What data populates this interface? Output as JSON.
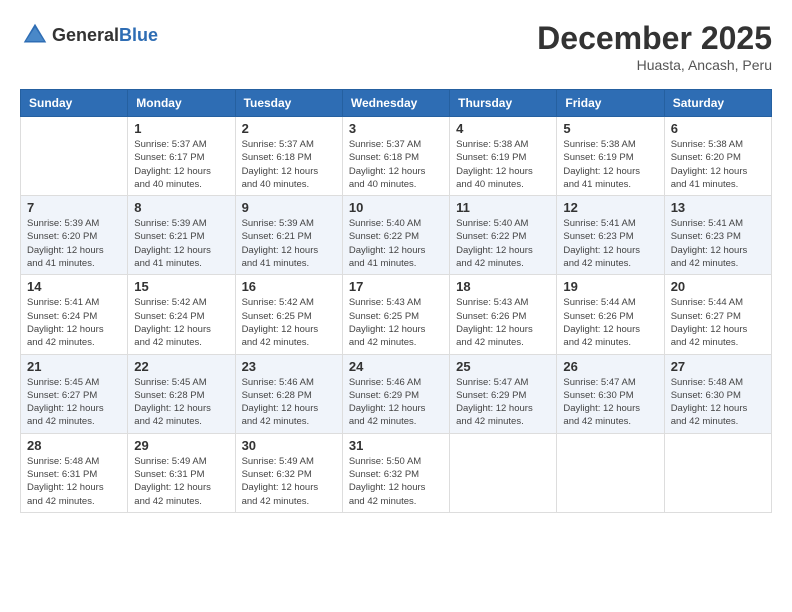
{
  "header": {
    "logo_general": "General",
    "logo_blue": "Blue",
    "title": "December 2025",
    "location": "Huasta, Ancash, Peru"
  },
  "weekdays": [
    "Sunday",
    "Monday",
    "Tuesday",
    "Wednesday",
    "Thursday",
    "Friday",
    "Saturday"
  ],
  "weeks": [
    [
      {
        "day": "",
        "info": ""
      },
      {
        "day": "1",
        "info": "Sunrise: 5:37 AM\nSunset: 6:17 PM\nDaylight: 12 hours\nand 40 minutes."
      },
      {
        "day": "2",
        "info": "Sunrise: 5:37 AM\nSunset: 6:18 PM\nDaylight: 12 hours\nand 40 minutes."
      },
      {
        "day": "3",
        "info": "Sunrise: 5:37 AM\nSunset: 6:18 PM\nDaylight: 12 hours\nand 40 minutes."
      },
      {
        "day": "4",
        "info": "Sunrise: 5:38 AM\nSunset: 6:19 PM\nDaylight: 12 hours\nand 40 minutes."
      },
      {
        "day": "5",
        "info": "Sunrise: 5:38 AM\nSunset: 6:19 PM\nDaylight: 12 hours\nand 41 minutes."
      },
      {
        "day": "6",
        "info": "Sunrise: 5:38 AM\nSunset: 6:20 PM\nDaylight: 12 hours\nand 41 minutes."
      }
    ],
    [
      {
        "day": "7",
        "info": "Sunrise: 5:39 AM\nSunset: 6:20 PM\nDaylight: 12 hours\nand 41 minutes."
      },
      {
        "day": "8",
        "info": "Sunrise: 5:39 AM\nSunset: 6:21 PM\nDaylight: 12 hours\nand 41 minutes."
      },
      {
        "day": "9",
        "info": "Sunrise: 5:39 AM\nSunset: 6:21 PM\nDaylight: 12 hours\nand 41 minutes."
      },
      {
        "day": "10",
        "info": "Sunrise: 5:40 AM\nSunset: 6:22 PM\nDaylight: 12 hours\nand 41 minutes."
      },
      {
        "day": "11",
        "info": "Sunrise: 5:40 AM\nSunset: 6:22 PM\nDaylight: 12 hours\nand 42 minutes."
      },
      {
        "day": "12",
        "info": "Sunrise: 5:41 AM\nSunset: 6:23 PM\nDaylight: 12 hours\nand 42 minutes."
      },
      {
        "day": "13",
        "info": "Sunrise: 5:41 AM\nSunset: 6:23 PM\nDaylight: 12 hours\nand 42 minutes."
      }
    ],
    [
      {
        "day": "14",
        "info": "Sunrise: 5:41 AM\nSunset: 6:24 PM\nDaylight: 12 hours\nand 42 minutes."
      },
      {
        "day": "15",
        "info": "Sunrise: 5:42 AM\nSunset: 6:24 PM\nDaylight: 12 hours\nand 42 minutes."
      },
      {
        "day": "16",
        "info": "Sunrise: 5:42 AM\nSunset: 6:25 PM\nDaylight: 12 hours\nand 42 minutes."
      },
      {
        "day": "17",
        "info": "Sunrise: 5:43 AM\nSunset: 6:25 PM\nDaylight: 12 hours\nand 42 minutes."
      },
      {
        "day": "18",
        "info": "Sunrise: 5:43 AM\nSunset: 6:26 PM\nDaylight: 12 hours\nand 42 minutes."
      },
      {
        "day": "19",
        "info": "Sunrise: 5:44 AM\nSunset: 6:26 PM\nDaylight: 12 hours\nand 42 minutes."
      },
      {
        "day": "20",
        "info": "Sunrise: 5:44 AM\nSunset: 6:27 PM\nDaylight: 12 hours\nand 42 minutes."
      }
    ],
    [
      {
        "day": "21",
        "info": "Sunrise: 5:45 AM\nSunset: 6:27 PM\nDaylight: 12 hours\nand 42 minutes."
      },
      {
        "day": "22",
        "info": "Sunrise: 5:45 AM\nSunset: 6:28 PM\nDaylight: 12 hours\nand 42 minutes."
      },
      {
        "day": "23",
        "info": "Sunrise: 5:46 AM\nSunset: 6:28 PM\nDaylight: 12 hours\nand 42 minutes."
      },
      {
        "day": "24",
        "info": "Sunrise: 5:46 AM\nSunset: 6:29 PM\nDaylight: 12 hours\nand 42 minutes."
      },
      {
        "day": "25",
        "info": "Sunrise: 5:47 AM\nSunset: 6:29 PM\nDaylight: 12 hours\nand 42 minutes."
      },
      {
        "day": "26",
        "info": "Sunrise: 5:47 AM\nSunset: 6:30 PM\nDaylight: 12 hours\nand 42 minutes."
      },
      {
        "day": "27",
        "info": "Sunrise: 5:48 AM\nSunset: 6:30 PM\nDaylight: 12 hours\nand 42 minutes."
      }
    ],
    [
      {
        "day": "28",
        "info": "Sunrise: 5:48 AM\nSunset: 6:31 PM\nDaylight: 12 hours\nand 42 minutes."
      },
      {
        "day": "29",
        "info": "Sunrise: 5:49 AM\nSunset: 6:31 PM\nDaylight: 12 hours\nand 42 minutes."
      },
      {
        "day": "30",
        "info": "Sunrise: 5:49 AM\nSunset: 6:32 PM\nDaylight: 12 hours\nand 42 minutes."
      },
      {
        "day": "31",
        "info": "Sunrise: 5:50 AM\nSunset: 6:32 PM\nDaylight: 12 hours\nand 42 minutes."
      },
      {
        "day": "",
        "info": ""
      },
      {
        "day": "",
        "info": ""
      },
      {
        "day": "",
        "info": ""
      }
    ]
  ]
}
